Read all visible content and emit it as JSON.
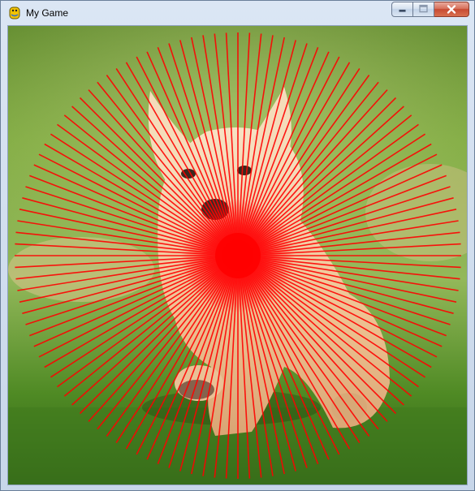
{
  "window": {
    "title": "My Game",
    "app_icon": "python-snake-icon",
    "controls": {
      "minimize": "minimize-icon",
      "maximize": "maximize-icon",
      "close": "close-icon"
    }
  },
  "scene": {
    "subject": "puppy-photo",
    "colors": {
      "ray": "#ff0000",
      "glow": "#ff0000",
      "grass_dark": "#3a6a1c",
      "grass_light": "#88b347",
      "fur": "#efc89a"
    },
    "ray_count": 120
  }
}
